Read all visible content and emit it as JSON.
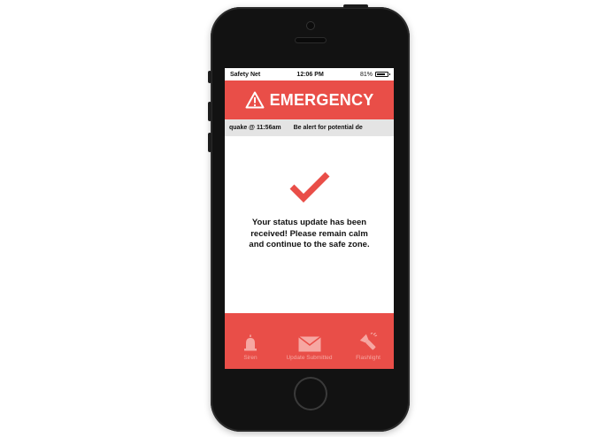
{
  "status_bar": {
    "carrier": "Safety Net",
    "time": "12:06 PM",
    "battery": "81%",
    "battery_level": 0.81
  },
  "header": {
    "title": "EMERGENCY",
    "icon": "warning-triangle-icon",
    "color": "#e94e48"
  },
  "ticker": {
    "items": [
      "quake @ 11:56am",
      "Be alert for potential de"
    ]
  },
  "main": {
    "icon": "checkmark-icon",
    "message": "Your status update has been received! Please remain calm and continue to the safe zone."
  },
  "tabbar": {
    "tabs": [
      {
        "icon": "siren-icon",
        "label": "Siren"
      },
      {
        "icon": "envelope-icon",
        "label": "Update Submitted"
      },
      {
        "icon": "flashlight-icon",
        "label": "Flashlight"
      }
    ]
  },
  "colors": {
    "accent": "#e94e48",
    "ticker_bg": "#e4e4e4",
    "tab_inactive": "#f6a7a2"
  }
}
